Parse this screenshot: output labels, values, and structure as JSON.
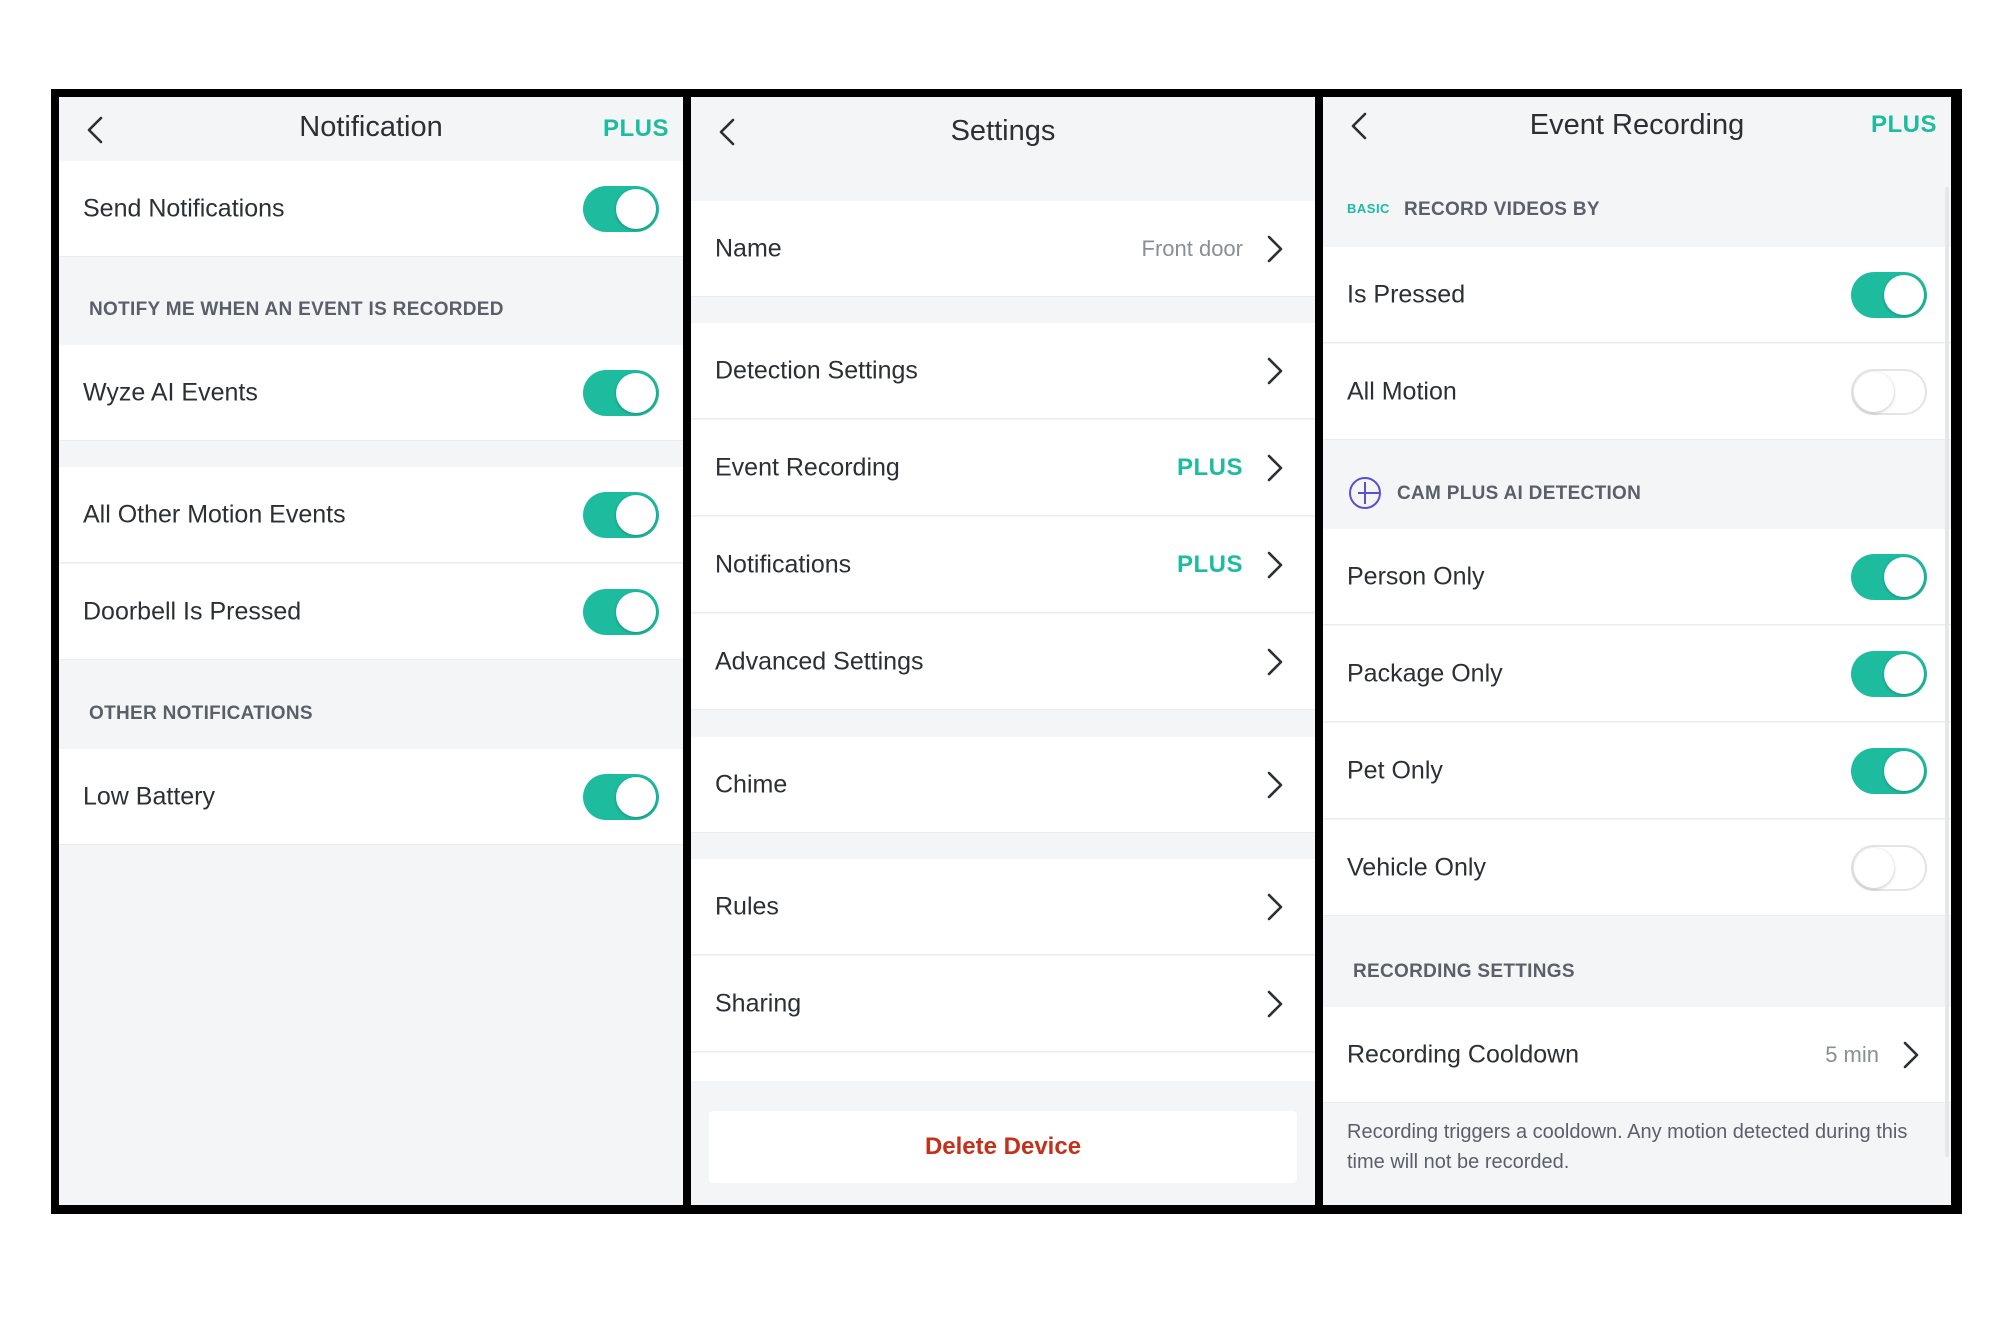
{
  "colors": {
    "accent": "#1ebc9f",
    "danger": "#c3311d"
  },
  "notification": {
    "title": "Notification",
    "plus_badge": "PLUS",
    "send_notifications": "Send Notifications",
    "section_events": "NOTIFY ME WHEN AN EVENT IS RECORDED",
    "wyze_ai_events": "Wyze AI Events",
    "all_other_motion": "All Other Motion Events",
    "doorbell_pressed": "Doorbell Is Pressed",
    "section_other": "OTHER NOTIFICATIONS",
    "low_battery": "Low Battery",
    "toggles": {
      "send_notifications": true,
      "wyze_ai_events": true,
      "all_other_motion": true,
      "doorbell_pressed": true,
      "low_battery": true
    }
  },
  "settings": {
    "title": "Settings",
    "name_label": "Name",
    "name_value": "Front door",
    "detection_settings": "Detection Settings",
    "event_recording": "Event Recording",
    "event_recording_badge": "PLUS",
    "notifications": "Notifications",
    "notifications_badge": "PLUS",
    "advanced_settings": "Advanced Settings",
    "chime": "Chime",
    "rules": "Rules",
    "sharing": "Sharing",
    "delete_device": "Delete Device"
  },
  "event_recording": {
    "title": "Event Recording",
    "plus_badge": "PLUS",
    "basic_tag": "BASIC",
    "section_record_by": "RECORD VIDEOS BY",
    "is_pressed": "Is Pressed",
    "all_motion": "All Motion",
    "section_cam_plus": "CAM PLUS AI DETECTION",
    "person_only": "Person Only",
    "package_only": "Package Only",
    "pet_only": "Pet Only",
    "vehicle_only": "Vehicle Only",
    "section_recording_settings": "RECORDING SETTINGS",
    "recording_cooldown": "Recording Cooldown",
    "recording_cooldown_value": "5 min",
    "footer_note": "Recording triggers a cooldown. Any motion detected during this time will not be recorded.",
    "toggles": {
      "is_pressed": true,
      "all_motion": false,
      "person_only": true,
      "package_only": true,
      "pet_only": true,
      "vehicle_only": false
    }
  }
}
